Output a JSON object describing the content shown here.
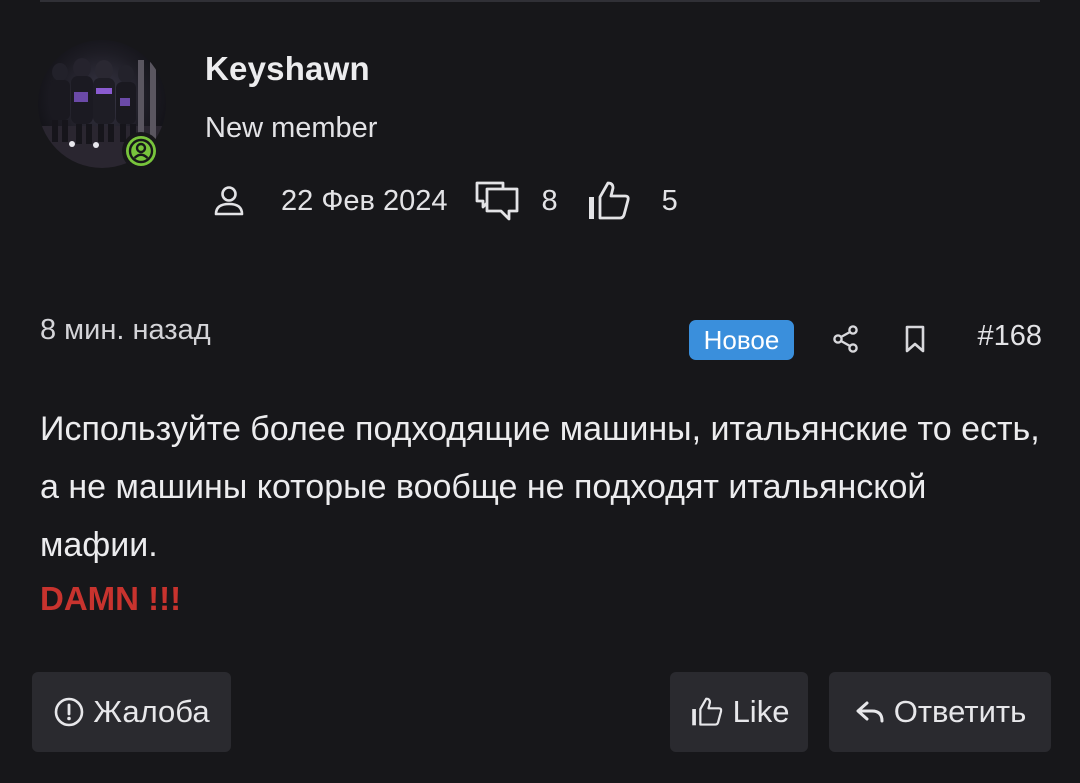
{
  "author": {
    "name": "Keyshawn",
    "title": "New member",
    "joined": "22 Фев 2024",
    "messages": "8",
    "reactions": "5",
    "status_color": "#78c43c"
  },
  "post": {
    "time": "8 мин. назад",
    "badge": "Новое",
    "number": "#168",
    "text": "Используйте более подходящие машины, итальянские то есть, а не машины которые вообще не подходят итальянской мафии.",
    "emphasis": "DAMN !!!"
  },
  "icons": {
    "joined": "user-icon",
    "messages": "comments-icon",
    "reactions": "thumbs-up-icon",
    "share": "share-icon",
    "bookmark": "bookmark-icon",
    "report": "alert-circle-icon",
    "like": "thumbs-up-icon",
    "reply": "reply-icon"
  },
  "actions": {
    "report": "Жалоба",
    "like": "Like",
    "reply": "Ответить"
  },
  "colors": {
    "background": "#17171a",
    "badge": "#3a8fdc",
    "emphasis": "#c8332e",
    "button": "#2a2a2f"
  }
}
